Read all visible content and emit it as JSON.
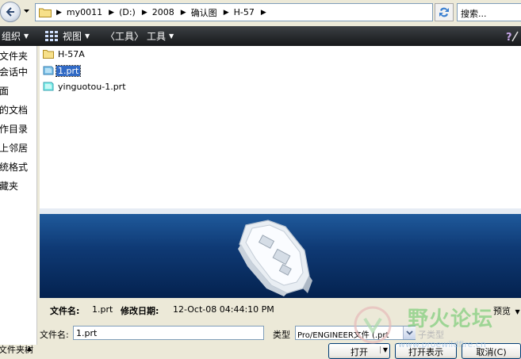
{
  "address": {
    "crumbs": [
      "my0011",
      "(D:)",
      "2008",
      "确认图",
      "H-57"
    ],
    "search_placeholder": "搜索..."
  },
  "toolbar": {
    "organize": "组织",
    "view": "视图",
    "tools_bracketed": "〈工具〉",
    "tools": "工具"
  },
  "sidebar": {
    "items": [
      "文件夹",
      "在会话中",
      "桌面",
      "我的文档",
      "工作目录",
      "网上邻居",
      "系统格式",
      "收藏夹"
    ],
    "footer": "文件夹树"
  },
  "files": [
    {
      "name": "H-57A",
      "icon": "folder-icon"
    },
    {
      "name": "1.prt",
      "icon": "part-file-icon",
      "selected": true
    },
    {
      "name": "yinguotou-1.prt",
      "icon": "part-file-icon"
    }
  ],
  "details": {
    "filename_label": "文件名:",
    "filename_value": "1.prt",
    "modified_label": "修改日期:",
    "modified_value": "12-Oct-08 04:44:10 PM",
    "preview_label": "预览"
  },
  "form": {
    "filename_label": "文件名:",
    "filename_value": "1.prt",
    "type_label": "类型",
    "type_value": "Pro/ENGINEER文件 (.prt",
    "type_ghost": "子类型"
  },
  "buttons": {
    "open": "打开",
    "open_rep": "打开表示",
    "cancel": "取消(C)"
  },
  "watermark": {
    "text": "野火论坛",
    "url": "www.proewildfire.cn"
  },
  "colors": {
    "selection": "#316ac5",
    "toolbar": "#2a2d30",
    "preview_bg": "#0f3a75"
  }
}
